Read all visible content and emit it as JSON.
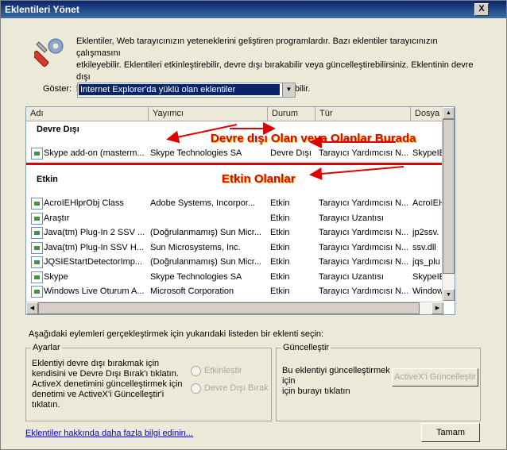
{
  "window": {
    "title": "Eklentileri Yönet",
    "close_glyph": "X"
  },
  "description": {
    "lines": [
      "Eklentiler, Web tarayıcınızın yeteneklerini geliştiren programlardır. Bazı eklentiler tarayıcınızın çalışmasını",
      "etkileyebilir. Eklentileri etkinleştirebilir, devre dışı bırakabilir veya güncelleştirebilirsiniz. Eklentinin devre dışı",
      "bırakılması, bazı Web sayfalarının çalışmasını engelleyebilir."
    ],
    "icon": "tools-wrench-gear-icon"
  },
  "show": {
    "label": "Göster:",
    "selected": "Internet Explorer'da yüklü olan eklentiler"
  },
  "columns": [
    "Adı",
    "Yayımcı",
    "Durum",
    "Tür",
    "Dosya"
  ],
  "groups": {
    "disabled": {
      "title": "Devre Dışı",
      "rows": [
        {
          "name": "Skype add-on (masterm...",
          "publisher": "Skype Technologies SA",
          "status": "Devre Dışı",
          "type": "Tarayıcı Yardımcısı N...",
          "file": "SkypeIE"
        }
      ]
    },
    "enabled": {
      "title": "Etkin",
      "rows": [
        {
          "name": "AcroIEHlprObj Class",
          "publisher": "Adobe Systems, Incorpor...",
          "status": "Etkin",
          "type": "Tarayıcı Yardımcısı N...",
          "file": "AcroIEH"
        },
        {
          "name": "Araştır",
          "publisher": "",
          "status": "Etkin",
          "type": "Tarayıcı Uzantısı",
          "file": ""
        },
        {
          "name": "Java(tm) Plug-In 2 SSV ...",
          "publisher": "(Doğrulanmamış) Sun Micr...",
          "status": "Etkin",
          "type": "Tarayıcı Yardımcısı N...",
          "file": "jp2ssv."
        },
        {
          "name": "Java(tm) Plug-In SSV H...",
          "publisher": "Sun Microsystems, Inc.",
          "status": "Etkin",
          "type": "Tarayıcı Yardımcısı N...",
          "file": "ssv.dll"
        },
        {
          "name": "JQSIEStartDetectorImp...",
          "publisher": "(Doğrulanmamış) Sun Micr...",
          "status": "Etkin",
          "type": "Tarayıcı Yardımcısı N...",
          "file": "jqs_plu"
        },
        {
          "name": "Skype",
          "publisher": "Skype Technologies SA",
          "status": "Etkin",
          "type": "Tarayıcı Uzantısı",
          "file": "SkypeIE"
        },
        {
          "name": "Windows Live Oturum A...",
          "publisher": "Microsoft Corporation",
          "status": "Etkin",
          "type": "Tarayıcı Yardımcısı N...",
          "file": "Window"
        }
      ]
    }
  },
  "annotations": {
    "disabled_text": "Devre dışı Olan veya Olanlar Burada",
    "enabled_text": "Etkin Olanlar",
    "color": "#e00000"
  },
  "actions": {
    "prompt": "Aşağıdaki eylemleri gerçekleştirmek için yukarıdaki listeden bir eklenti seçin:"
  },
  "settings": {
    "legend": "Ayarlar",
    "text_lines": [
      "Eklentiyi devre dışı bırakmak için",
      "kendisini ve Devre Dışı Bırak'ı tıklatın.",
      "ActiveX denetimini güncelleştirmek için",
      "denetimi ve ActiveX'i Güncelleştir'i",
      "tıklatın."
    ],
    "radio_enable": "Etkinleştir",
    "radio_disable": "Devre Dışı Bırak"
  },
  "update": {
    "legend": "Güncelleştir",
    "text_lines": [
      "Bu eklentiyi güncelleştirmek için",
      "için burayı tıklatın"
    ],
    "button": "ActiveX'i Güncelleştir"
  },
  "footer": {
    "link": "Eklentiler hakkında daha fazla bilgi edinin...",
    "close_button": "Tamam"
  }
}
